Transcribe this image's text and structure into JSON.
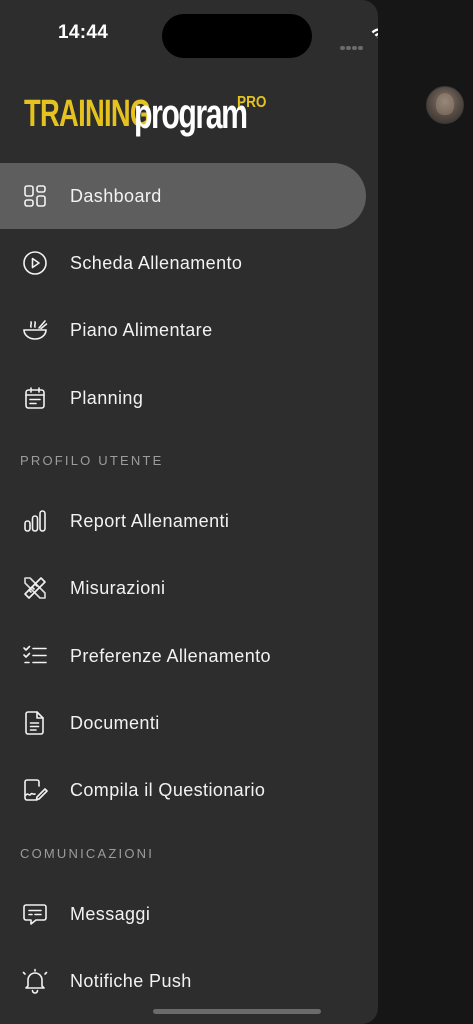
{
  "status_bar": {
    "time": "14:44"
  },
  "logo": {
    "training": "TRAINING",
    "program": "program",
    "pro": "PRO"
  },
  "menu": {
    "main_items": [
      {
        "label": "Dashboard",
        "icon": "dashboard-grid-icon",
        "active": true
      },
      {
        "label": "Scheda Allenamento",
        "icon": "play-circle-icon",
        "active": false
      },
      {
        "label": "Piano Alimentare",
        "icon": "food-bowl-icon",
        "active": false
      },
      {
        "label": "Planning",
        "icon": "calendar-icon",
        "active": false
      }
    ],
    "profile_header": "PROFILO UTENTE",
    "profile_items": [
      {
        "label": "Report Allenamenti",
        "icon": "bar-chart-icon"
      },
      {
        "label": "Misurazioni",
        "icon": "ruler-pencil-icon"
      },
      {
        "label": "Preferenze Allenamento",
        "icon": "checklist-icon"
      },
      {
        "label": "Documenti",
        "icon": "document-icon"
      },
      {
        "label": "Compila il Questionario",
        "icon": "signature-document-icon"
      }
    ],
    "comm_header": "COMUNICAZIONI",
    "comm_items": [
      {
        "label": "Messaggi",
        "icon": "message-icon"
      },
      {
        "label": "Notifiche Push",
        "icon": "bell-icon"
      }
    ]
  },
  "colors": {
    "drawer_bg": "#2d2d2d",
    "active_bg": "#5e5e5e",
    "accent_yellow": "#e6c21e",
    "section_text": "#9c9c9c"
  }
}
